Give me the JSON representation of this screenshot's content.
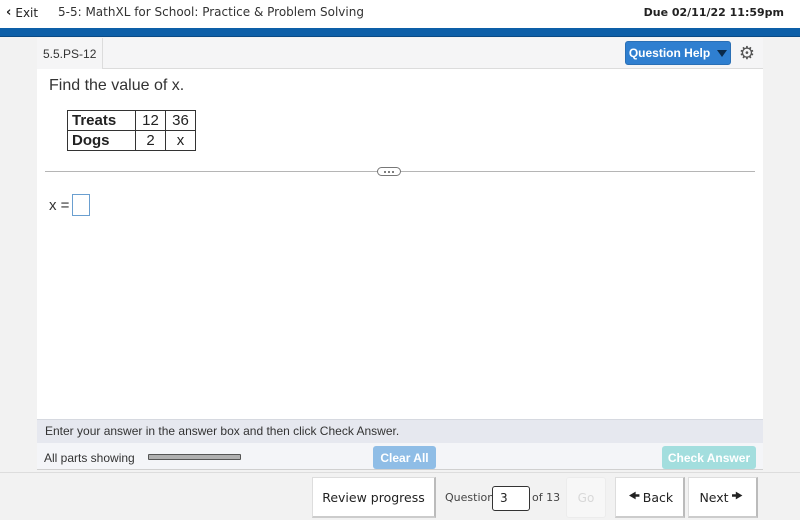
{
  "topbar": {
    "exit_label": "Exit",
    "exit_icon": "chevron-left-icon",
    "course_title": "5-5: MathXL for School: Practice & Problem Solving",
    "due": "Due 02/11/22 11:59pm",
    "accent_color": "#0d5fa8"
  },
  "question_header": {
    "id": "5.5.PS-12",
    "help_label": "Question Help",
    "help_icon": "caret-down-icon",
    "settings_icon": "gear-icon"
  },
  "question": {
    "prompt": "Find the value of x.",
    "table": {
      "rows": [
        {
          "label": "Treats",
          "values": [
            "12",
            "36"
          ]
        },
        {
          "label": "Dogs",
          "values": [
            "2",
            "x"
          ]
        }
      ]
    },
    "expander_icon": "more-dots-icon",
    "answer_label": "x =",
    "answer_value": ""
  },
  "footer": {
    "instruction": "Enter your answer in the answer box and then click Check Answer.",
    "parts_label": "All parts showing",
    "clear_all_label": "Clear All",
    "check_answer_label": "Check Answer"
  },
  "navigation": {
    "review_label": "Review progress",
    "question_label": "Question",
    "question_number": "3",
    "of_label": "of 13",
    "go_label": "Go",
    "back_label": "Back",
    "next_label": "Next",
    "back_icon": "arrow-left-icon",
    "next_icon": "arrow-right-icon"
  }
}
